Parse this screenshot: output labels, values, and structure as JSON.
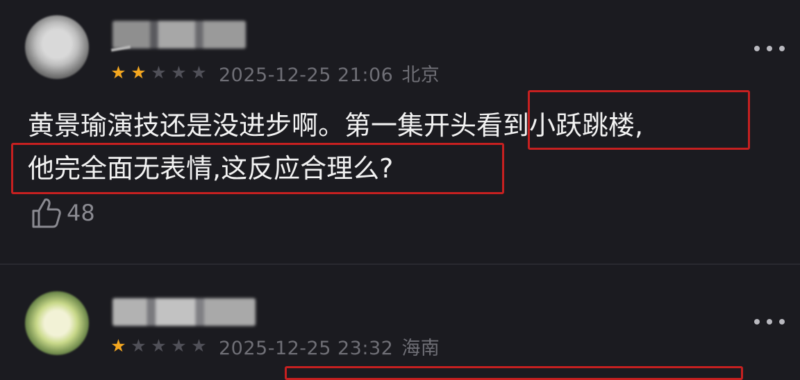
{
  "comments": [
    {
      "rating": 2,
      "max_rating": 5,
      "timestamp": "2025-12-25 21:06",
      "location": "北京",
      "text_lines": [
        "黄景瑜演技还是没进步啊。第一集开头看到小跃跳楼,",
        "他完全面无表情,这反应合理么?"
      ],
      "likes": "48"
    },
    {
      "rating": 1,
      "max_rating": 5,
      "timestamp": "2025-12-25 23:32",
      "location": "海南"
    }
  ],
  "colors": {
    "background": "#1b1b20",
    "star_active": "#f4a720",
    "star_inactive": "#505058",
    "highlight_box": "#c62020",
    "meta_text": "#6f6f76"
  },
  "icons": {
    "more": "more-dots-icon",
    "like": "thumb-up-icon",
    "star": "star-icon"
  }
}
